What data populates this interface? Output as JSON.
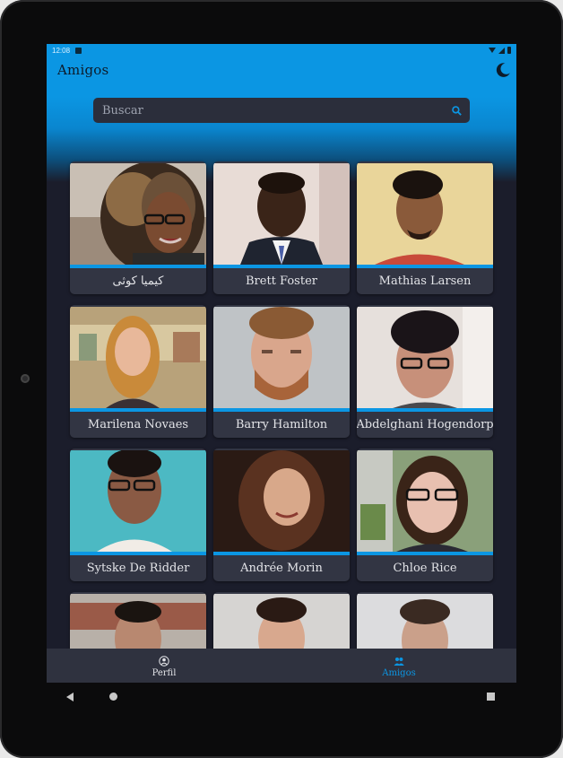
{
  "status_bar": {
    "time": "12:08"
  },
  "app": {
    "title": "Amigos",
    "theme_toggle_icon": "moon-icon"
  },
  "search": {
    "placeholder": "Buscar",
    "value": "",
    "icon": "search-icon"
  },
  "friends": [
    {
      "name": "کیمیا کوثی"
    },
    {
      "name": "Brett Foster"
    },
    {
      "name": "Mathias Larsen"
    },
    {
      "name": "Marilena Novaes"
    },
    {
      "name": "Barry Hamilton"
    },
    {
      "name": "Abdelghani Hogendorp"
    },
    {
      "name": "Sytske De Ridder"
    },
    {
      "name": "Andrée Morin"
    },
    {
      "name": "Chloe Rice"
    },
    {
      "name": ""
    },
    {
      "name": ""
    },
    {
      "name": ""
    }
  ],
  "bottom_nav": {
    "items": [
      {
        "label": "Perfil",
        "icon": "profile-icon",
        "active": false
      },
      {
        "label": "Amigos",
        "icon": "people-icon",
        "active": true
      }
    ]
  },
  "colors": {
    "accent": "#0b96e3",
    "background": "#1b1d2b",
    "card": "#323543",
    "nav": "#2f323f"
  }
}
